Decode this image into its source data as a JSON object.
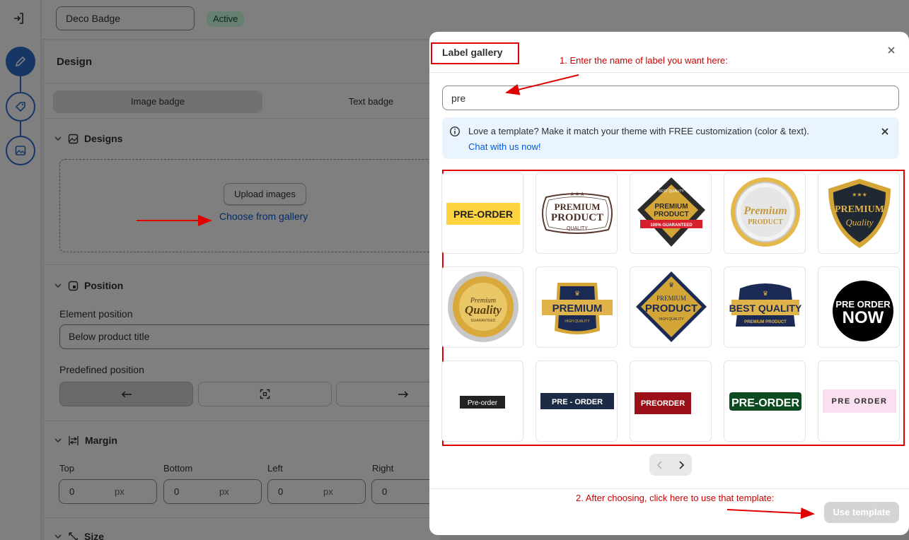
{
  "topbar": {
    "badge_name": "Deco Badge",
    "status": "Active"
  },
  "panel": {
    "title": "Design",
    "tabs": [
      "Image badge",
      "Text badge"
    ],
    "designs": {
      "title": "Designs",
      "upload_label": "Upload images",
      "gallery_link": "Choose from gallery"
    },
    "position": {
      "title": "Position",
      "element_label": "Element position",
      "element_value": "Below product title",
      "predefined_label": "Predefined position"
    },
    "margin": {
      "title": "Margin",
      "fields": [
        {
          "label": "Top",
          "value": "0",
          "unit": "px"
        },
        {
          "label": "Bottom",
          "value": "0",
          "unit": "px"
        },
        {
          "label": "Left",
          "value": "0",
          "unit": "px"
        },
        {
          "label": "Right",
          "value": "0",
          "unit": ""
        }
      ]
    },
    "size": {
      "title": "Size"
    }
  },
  "modal": {
    "title": "Label gallery",
    "search_value": "pre",
    "banner": {
      "message": "Love a template? Make it match your theme with FREE customization (color & text).",
      "link": "Chat with us now!"
    },
    "use_template_label": "Use template",
    "badges": {
      "b1": "PRE-ORDER",
      "b2_top": "PREMIUM",
      "b2_mid": "PRODUCT",
      "b2_bot": "QUALITY",
      "b3_top": "BEST QUALITY",
      "b3_mid1": "PREMIUM",
      "b3_mid2": "PRODUCT",
      "b3_ribbon": "100% GUARANTEED",
      "b4_top": "Premium",
      "b4_bot": "PRODUCT",
      "b5_top": "PREMIUM",
      "b5_bot": "Quality",
      "b6_top": "Premium",
      "b6_mid": "Quality",
      "b6_bot": "GUARANTEED",
      "b7_mid": "PREMIUM",
      "b7_bot": "HIGH QUALITY",
      "b8_top": "PREMIUM",
      "b8_mid": "PRODUCT",
      "b8_bot": "HIGH QUALITY",
      "b9_mid": "BEST QUALITY",
      "b9_bot": "PREMIUM PRODUCT",
      "b10_top": "PRE ORDER",
      "b10_bot": "NOW",
      "b11": "Pre-order",
      "b12": "PRE - ORDER",
      "b13": "PREORDER",
      "b14": "PRE-ORDER",
      "b15": "PRE ORDER"
    }
  },
  "annotations": {
    "step1": "1. Enter the name of label you want here:",
    "step2": "2. After choosing, click here to use that template:"
  },
  "colors": {
    "annotation": "#e00000",
    "link": "#005bd3",
    "step_blue": "#2c6ecb",
    "info_bg": "#eaf4ff"
  }
}
